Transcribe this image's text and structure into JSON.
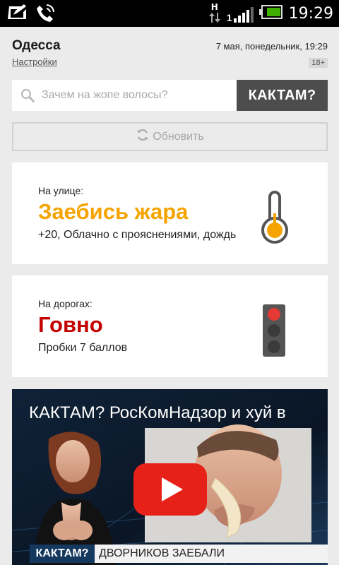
{
  "statusbar": {
    "time": "19:29",
    "network_letter": "H",
    "signal_label": "1"
  },
  "header": {
    "city": "Одесса",
    "settings_link": "Настройки",
    "date": "7 мая, понедельник, 19:29",
    "age_badge": "18+"
  },
  "search": {
    "placeholder": "Зачем на жопе волосы?",
    "button_label": "КАКТАМ?"
  },
  "refresh": {
    "label": "Обновить"
  },
  "weather": {
    "label": "На улице:",
    "headline": "Заебись жара",
    "description": "+20, Облачно с прояснениями, дождь",
    "accent_color": "#f5a300"
  },
  "roads": {
    "label": "На дорогах:",
    "headline": "Говно",
    "description": "Пробки 7 баллов",
    "accent_color": "#c40000"
  },
  "video": {
    "title": "КАКТАМ? РосКомНадзор и хуй в",
    "ticker_brand": "КАКТАМ?",
    "ticker_text": "ДВОРНИКОВ ЗАЕБАЛИ"
  },
  "icons": {
    "status_left": [
      "message-icon",
      "phone-icon"
    ],
    "search": "search-icon",
    "refresh": "refresh-icon",
    "weather": "thermometer-icon",
    "roads": "traffic-light-icon",
    "video": "play-icon"
  }
}
